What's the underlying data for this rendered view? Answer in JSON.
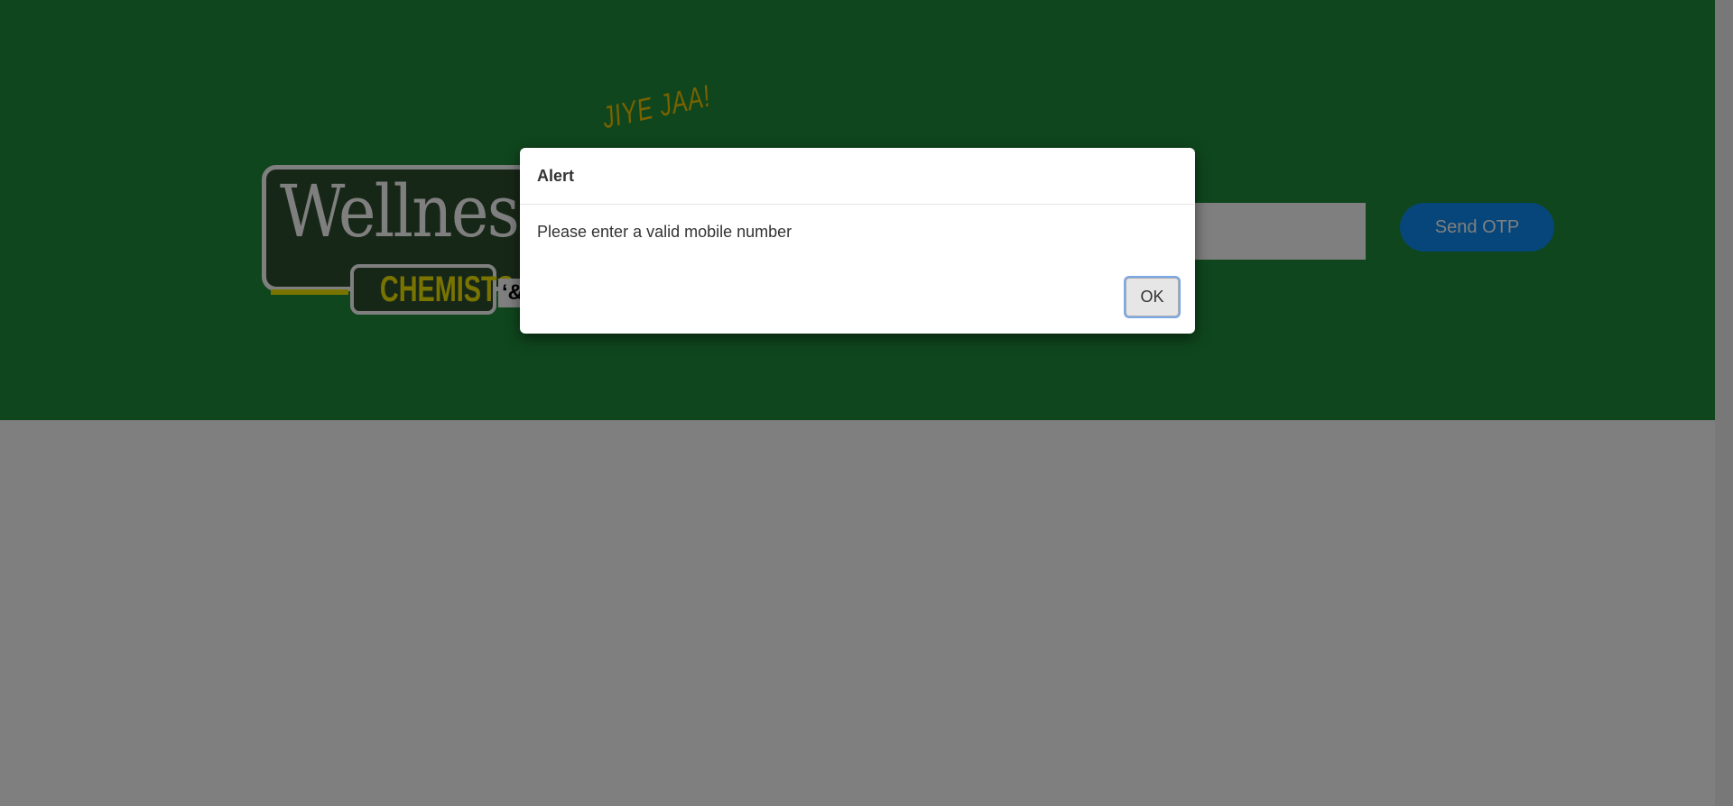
{
  "logo": {
    "word": "Wellness",
    "tag": "CHEMISTS",
    "amp": "‘&"
  },
  "slogan": "JIYE JAA!",
  "form": {
    "mobile_value": "",
    "send_otp_label": "Send OTP"
  },
  "dialog": {
    "title": "Alert",
    "message": "Please enter a valid mobile number",
    "ok_label": "OK"
  },
  "colors": {
    "hero_green": "#1e8c3a",
    "button_blue": "#0d8cf5",
    "logo_yellow": "#f2e800",
    "slogan_gold": "#f2c300",
    "overlay": "rgba(0,0,0,0.5)"
  }
}
